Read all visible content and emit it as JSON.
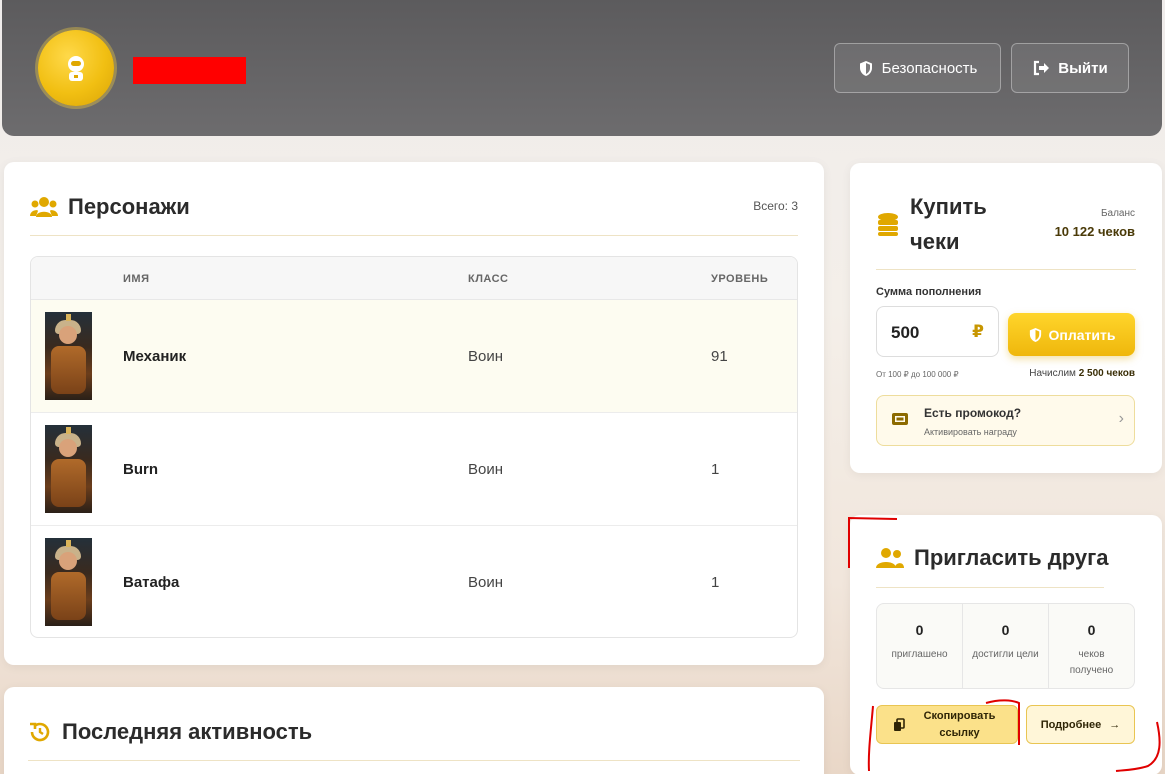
{
  "header": {
    "security_label": "Безопасность",
    "logout_label": "Выйти",
    "icons": {
      "avatar": "astronaut-icon",
      "security": "shield-icon",
      "logout": "logout-icon"
    },
    "accent_color": "#f1bf12"
  },
  "characters": {
    "title": "Персонажи",
    "total": "Всего: 3",
    "columns": {
      "name": "ИМЯ",
      "class": "КЛАСС",
      "level": "УРОВЕНЬ"
    },
    "rows": [
      {
        "name": "Механик",
        "class": "Воин",
        "level": "91"
      },
      {
        "name": "Burn",
        "class": "Воин",
        "level": "1"
      },
      {
        "name": "Ватафа",
        "class": "Воин",
        "level": "1"
      }
    ]
  },
  "activity": {
    "title": "Последняя активность"
  },
  "buy": {
    "title_line1": "Купить",
    "title_line2": "чеки",
    "balance_label": "Баланс",
    "balance_value": "10 122 чеков",
    "sum_label": "Сумма пополнения",
    "amount_value": "500",
    "currency": "₽",
    "pay_label": "Оплатить",
    "range": "От 100 ₽ до 100 000 ₽",
    "bonus_prefix": "Начислим ",
    "bonus_value": "2 500 чеков",
    "promo_title": "Есть промокод?",
    "promo_subtitle": "Активировать награду",
    "promo_chevron": "›"
  },
  "invite": {
    "title": "Пригласить друга",
    "stats": [
      {
        "value": "0",
        "label": "приглашено"
      },
      {
        "value": "0",
        "label": "достигли цели"
      },
      {
        "value": "0",
        "label": "чеков получено"
      }
    ],
    "copy_label": "Скопировать ссылку",
    "more_label": "Подробнее",
    "more_arrow": "→"
  }
}
